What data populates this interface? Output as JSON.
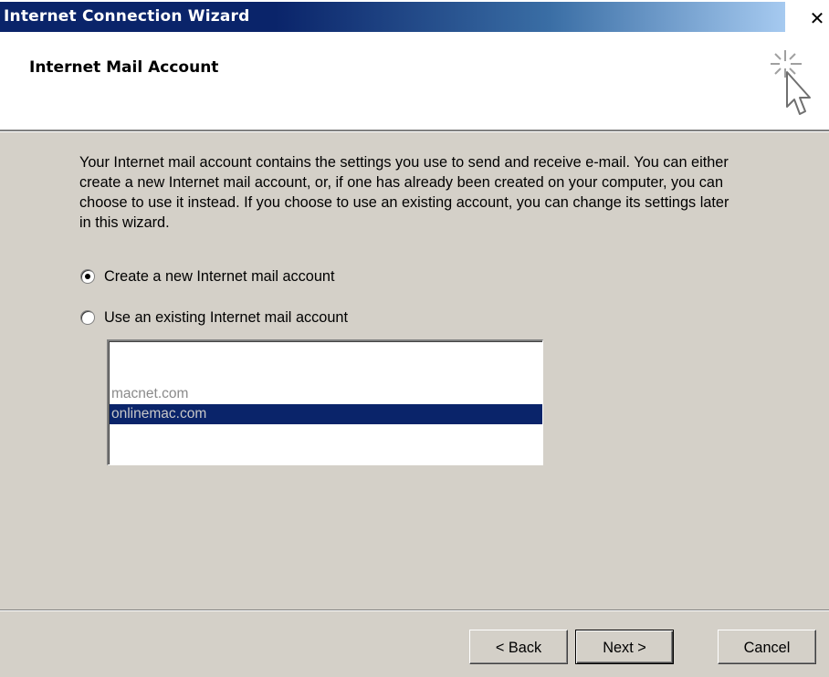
{
  "window": {
    "title": "Internet Connection Wizard",
    "close_glyph": "✕",
    "icon": "wizard-cursor-sparkle-icon"
  },
  "header": {
    "heading": "Internet Mail Account"
  },
  "body": {
    "description": "Your Internet mail account contains the settings you use to send and receive e-mail. You can either create a new Internet mail account, or, if one has already been created on your computer, you can choose to use it instead. If you choose to use an existing account, you can change its settings later in this wizard.",
    "options": [
      {
        "label": "Create a new Internet mail account",
        "checked": true
      },
      {
        "label": "Use an existing Internet mail account",
        "checked": false
      }
    ],
    "accounts": [
      {
        "label": "macnet.com",
        "selected": false
      },
      {
        "label": "onlinemac.com",
        "selected": true
      }
    ]
  },
  "footer": {
    "back_label": "< Back",
    "next_label": "Next >",
    "cancel_label": "Cancel"
  },
  "colors": {
    "title_bar": "#0a246a",
    "dialog_face": "#d4d0c8",
    "selection": "#0a246a"
  }
}
